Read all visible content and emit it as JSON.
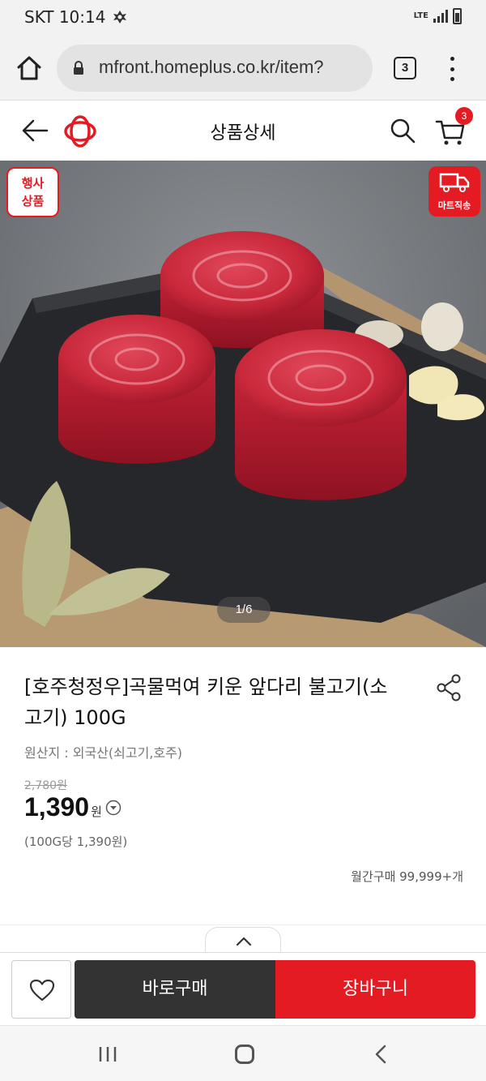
{
  "status_bar": {
    "time": "SKT 10:14",
    "network": "LTE"
  },
  "browser": {
    "url": "mfront.homeplus.co.kr/item?",
    "tab_count": "3"
  },
  "header": {
    "title": "상품상세",
    "cart_count": "3"
  },
  "product": {
    "event_badge": "행사\n상품",
    "delivery_badge": "마트직송",
    "image_counter": "1/6",
    "title": "[호주청정우]곡물먹여 키운 앞다리 불고기(소고기) 100G",
    "origin": "원산지 : 외국산(쇠고기,호주)",
    "original_price": "2,780원",
    "sale_price": "1,390",
    "price_unit": "원",
    "unit_price": "(100G당 1,390원)",
    "monthly_sales": "월간구매 99,999+개"
  },
  "actions": {
    "buy_now": "바로구매",
    "add_to_cart": "장바구니"
  },
  "colors": {
    "brand_red": "#e41b23",
    "buy_now_bg": "#333333"
  },
  "icons": [
    "home-icon",
    "lock-icon",
    "menu-icon",
    "back-arrow-icon",
    "homeplus-logo",
    "search-icon",
    "cart-icon",
    "truck-icon",
    "share-icon",
    "price-info-icon",
    "chevron-up-icon",
    "heart-icon",
    "recent-apps-icon",
    "home-nav-icon",
    "back-nav-icon"
  ]
}
